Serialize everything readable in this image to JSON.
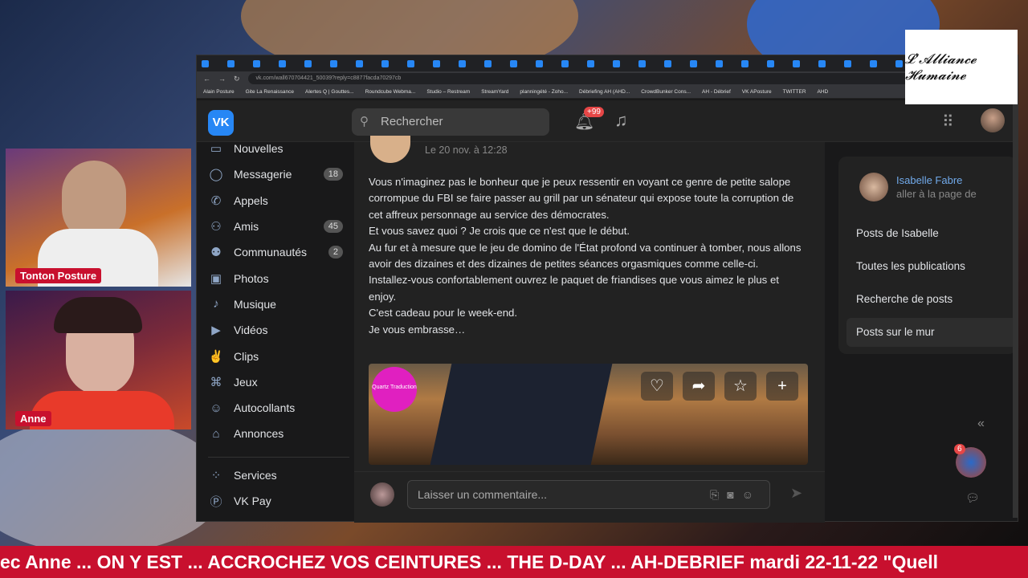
{
  "stream": {
    "cams": [
      {
        "name": "Tonton Posture"
      },
      {
        "name": "Anne"
      }
    ],
    "logo_text": "L'Alliance Humaine",
    "ticker": "ec Anne ... ON Y EST ... ACCROCHEZ VOS CEINTURES ... THE D-DAY ... AH-DEBRIEF mardi 22-11-22 \"Quell"
  },
  "browser": {
    "url": "vk.com/wall670704421_50039?reply=c8877facda70297cb",
    "bookmarks": [
      "Alain Posture",
      "Gite La Renaissance",
      "Alertes Q | Gouttes...",
      "Roundcube Webma...",
      "Studio – Restream",
      "StreamYard",
      "planningété - Zoho...",
      "Débriefing AH (AHD...",
      "CrowdBunker Cons...",
      "AH - Débrief",
      "VK APosture",
      "TWITTER",
      "AHD"
    ]
  },
  "vk": {
    "logo": "VK",
    "search_placeholder": "Rechercher",
    "notif_badge": "+99",
    "nav": [
      {
        "label": "Nouvelles",
        "icon": "news-icon"
      },
      {
        "label": "Messagerie",
        "icon": "message-icon",
        "count": "18"
      },
      {
        "label": "Appels",
        "icon": "phone-icon"
      },
      {
        "label": "Amis",
        "icon": "friends-icon",
        "count": "45"
      },
      {
        "label": "Communautés",
        "icon": "communities-icon",
        "count": "2"
      },
      {
        "label": "Photos",
        "icon": "photo-icon"
      },
      {
        "label": "Musique",
        "icon": "music-icon"
      },
      {
        "label": "Vidéos",
        "icon": "video-icon"
      },
      {
        "label": "Clips",
        "icon": "clips-icon"
      },
      {
        "label": "Jeux",
        "icon": "games-icon"
      },
      {
        "label": "Autocollants",
        "icon": "sticker-icon"
      },
      {
        "label": "Annonces",
        "icon": "ads-icon"
      }
    ],
    "nav2": [
      {
        "label": "Services",
        "icon": "services-icon"
      },
      {
        "label": "VK Pay",
        "icon": "vkpay-icon"
      }
    ],
    "post": {
      "date": "Le 20 nov. à 12:28",
      "paragraphs": [
        "Vous n'imaginez pas le bonheur que je peux ressentir en voyant ce genre de petite salope corrompue du FBI se faire passer au grill par un sénateur qui expose toute la corruption de cet affreux personnage au service des démocrates.",
        "Et vous savez quoi ? Je crois que ce n'est que le début.",
        "Au fur et à mesure que le jeu de domino de l'État profond va continuer à tomber, nous allons avoir des dizaines et des dizaines de petites séances orgasmiques comme celle-ci.",
        "Installez-vous confortablement ouvrez le paquet de friandises que vous aimez le plus et enjoy.",
        "C'est cadeau pour le week-end.",
        "Je vous embrasse…"
      ],
      "video_watermark": "Quartz Traduction",
      "comment_placeholder": "Laisser un commentaire..."
    },
    "right": {
      "name": "Isabelle Fabre",
      "sub": "aller à la page de",
      "links": [
        "Posts de Isabelle",
        "Toutes les publications",
        "Recherche de posts",
        "Posts sur le mur"
      ],
      "active": 3,
      "chat_badge": "6"
    }
  }
}
